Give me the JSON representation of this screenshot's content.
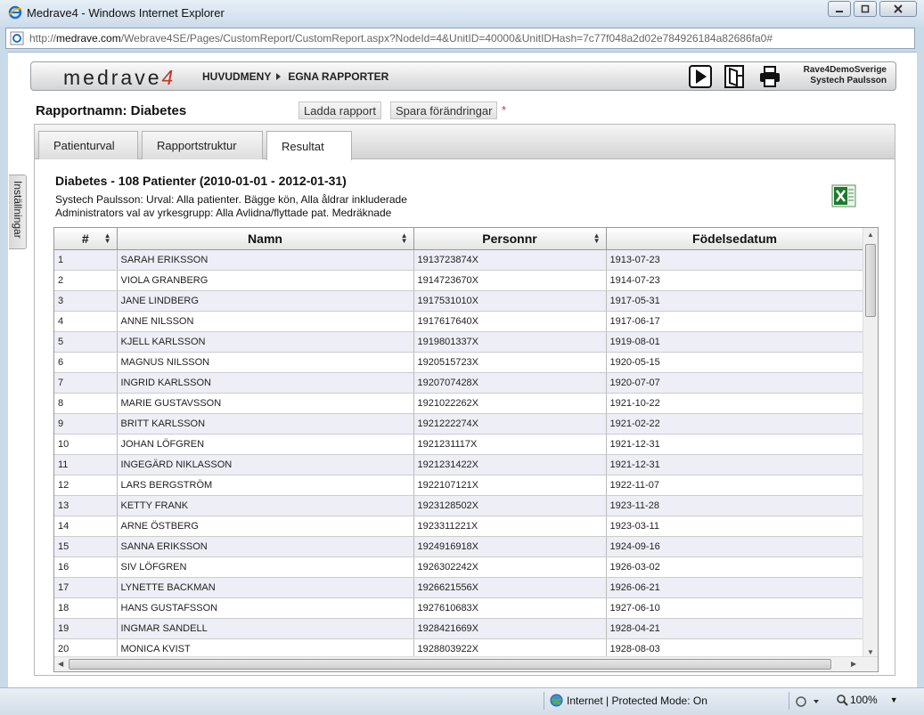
{
  "window": {
    "title": "Medrave4 - Windows Internet Explorer",
    "url_prefix": "http://",
    "url_host": "medrave.com",
    "url_rest": "/Webrave4SE/Pages/CustomReport/CustomReport.aspx?NodeId=4&UnitID=40000&UnitIDHash=7c77f048a2d02e784926184a82686fa0#"
  },
  "header": {
    "logo_text": "medrave",
    "logo_num": "4",
    "nav": [
      "HUVUDMENY",
      "EGNA RAPPORTER"
    ],
    "user_line1": "Rave4DemoSverige",
    "user_line2": "Systech Paulsson"
  },
  "report": {
    "name": "Rapportnamn: Diabetes",
    "load_label": "Ladda rapport",
    "save_label": "Spara förändringar",
    "asterisk": "*"
  },
  "tabs": [
    {
      "label": "Patienturval"
    },
    {
      "label": "Rapportstruktur"
    },
    {
      "label": "Resultat"
    }
  ],
  "side_tab": "Inställningar",
  "result": {
    "title": "Diabetes - 108 Patienter (2010-01-01 - 2012-01-31)",
    "desc1": "Systech Paulsson: Urval: Alla patienter. Bägge kön, Alla åldrar inkluderade",
    "desc2": "Administrators val av yrkesgrupp: Alla Avlidna/flyttade pat. Medräknade"
  },
  "table": {
    "columns": [
      "#",
      "Namn",
      "Personnr",
      "Födelsedatum"
    ],
    "rows": [
      [
        "1",
        "SARAH ERIKSSON",
        "1913723874X",
        "1913-07-23"
      ],
      [
        "2",
        "VIOLA GRANBERG",
        "1914723670X",
        "1914-07-23"
      ],
      [
        "3",
        "JANE LINDBERG",
        "1917531010X",
        "1917-05-31"
      ],
      [
        "4",
        "ANNE NILSSON",
        "1917617640X",
        "1917-06-17"
      ],
      [
        "5",
        "KJELL KARLSSON",
        "1919801337X",
        "1919-08-01"
      ],
      [
        "6",
        "MAGNUS NILSSON",
        "1920515723X",
        "1920-05-15"
      ],
      [
        "7",
        "INGRID KARLSSON",
        "1920707428X",
        "1920-07-07"
      ],
      [
        "8",
        "MARIE GUSTAVSSON",
        "1921022262X",
        "1921-10-22"
      ],
      [
        "9",
        "BRITT KARLSSON",
        "1921222274X",
        "1921-02-22"
      ],
      [
        "10",
        "JOHAN LÖFGREN",
        "1921231117X",
        "1921-12-31"
      ],
      [
        "11",
        "INGEGÄRD NIKLASSON",
        "1921231422X",
        "1921-12-31"
      ],
      [
        "12",
        "LARS BERGSTRÖM",
        "1922107121X",
        "1922-11-07"
      ],
      [
        "13",
        "KETTY FRANK",
        "1923128502X",
        "1923-11-28"
      ],
      [
        "14",
        "ARNE ÖSTBERG",
        "1923311221X",
        "1923-03-11"
      ],
      [
        "15",
        "SANNA ERIKSSON",
        "1924916918X",
        "1924-09-16"
      ],
      [
        "16",
        "SIV LÖFGREN",
        "1926302242X",
        "1926-03-02"
      ],
      [
        "17",
        "LYNETTE BACKMAN",
        "1926621556X",
        "1926-06-21"
      ],
      [
        "18",
        "HANS GUSTAFSSON",
        "1927610683X",
        "1927-06-10"
      ],
      [
        "19",
        "INGMAR SANDELL",
        "1928421669X",
        "1928-04-21"
      ],
      [
        "20",
        "MONICA KVIST",
        "1928803922X",
        "1928-08-03"
      ]
    ]
  },
  "status": {
    "zone": "Internet | Protected Mode: On",
    "zoom": "100%"
  }
}
